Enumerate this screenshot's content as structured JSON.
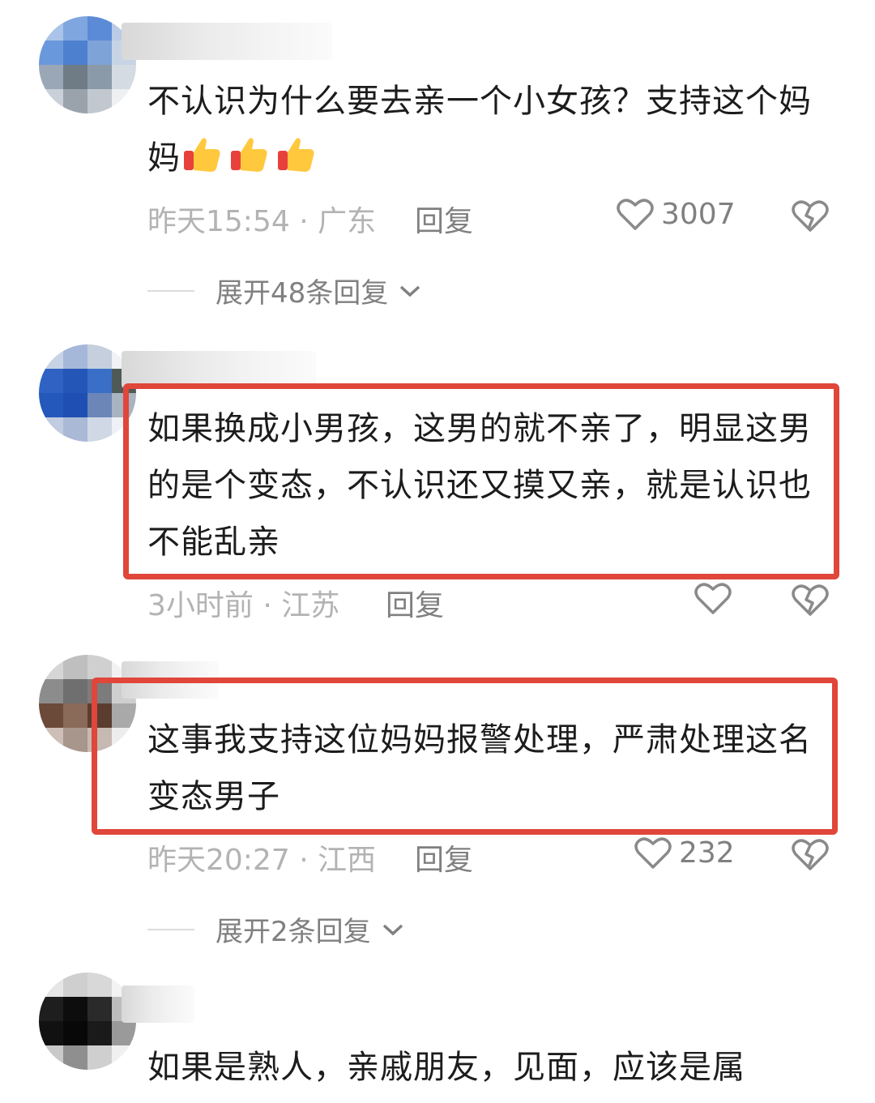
{
  "colors": {
    "highlight_box": "#e0463a",
    "meta_text": "#b3b3b3",
    "secondary_text": "#808080"
  },
  "comments": [
    {
      "text": "不认识为什么要去亲一个小女孩？支持这个妈妈",
      "emoji": [
        "thumbs-up-emoji",
        "thumbs-up-emoji",
        "thumbs-up-emoji"
      ],
      "time_location": "昨天15:54 · 广东",
      "reply_label": "回复",
      "likes": "3007",
      "expand_label": "展开48条回复"
    },
    {
      "text": "如果换成小男孩，这男的就不亲了，明显这男的是个变态，不认识还又摸又亲，就是认识也不能乱亲",
      "time_location": "3小时前 · 江苏",
      "reply_label": "回复"
    },
    {
      "text": "这事我支持这位妈妈报警处理，严肃处理这名变态男子",
      "time_location": "昨天20:27 · 江西",
      "reply_label": "回复",
      "likes": "232",
      "expand_label": "展开2条回复"
    },
    {
      "text": "如果是熟人，亲戚朋友，见面，应该是属"
    }
  ]
}
